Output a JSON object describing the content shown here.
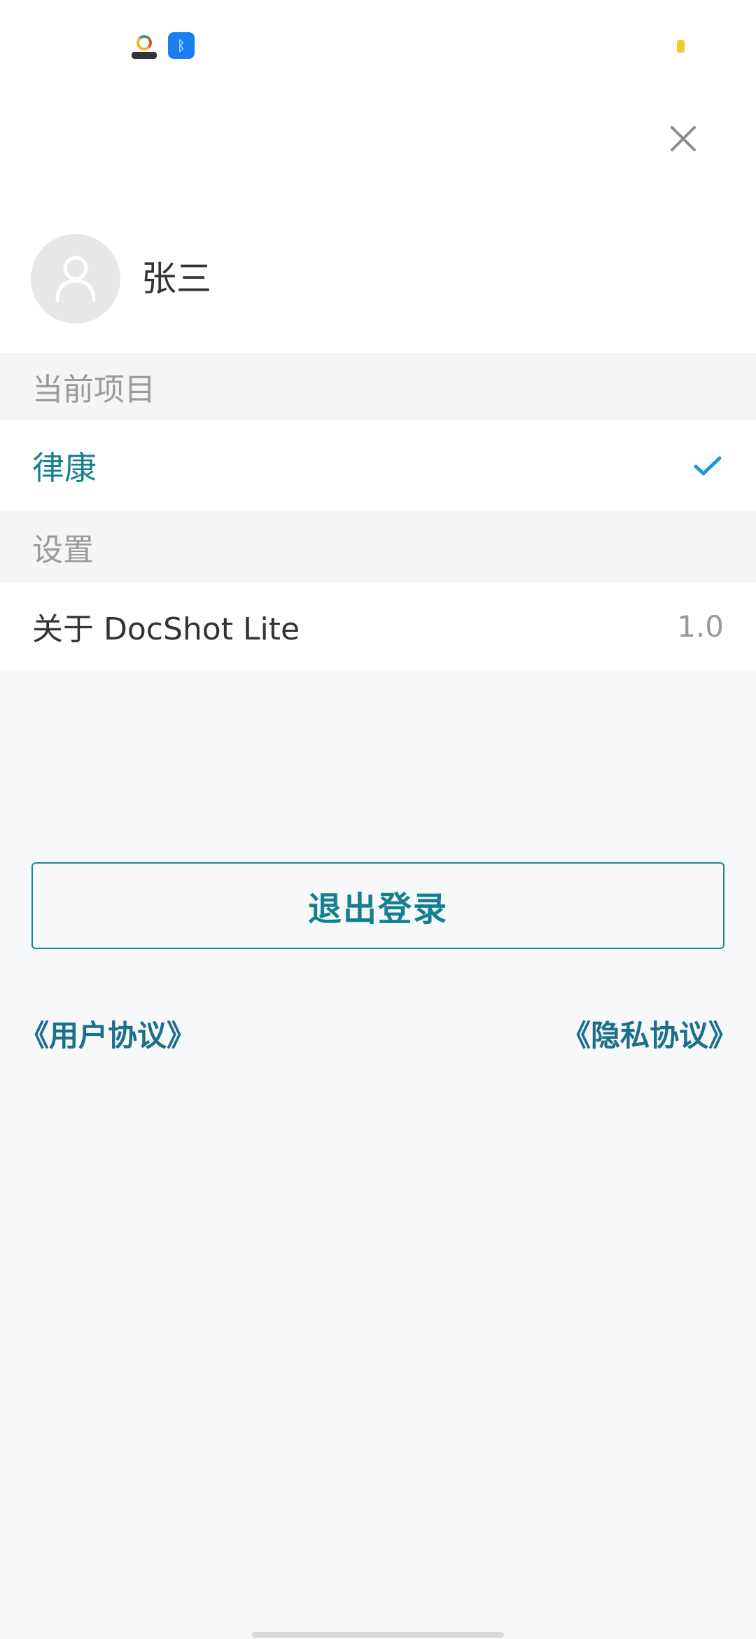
{
  "user": {
    "name": "张三"
  },
  "sections": {
    "current_project": "当前项目",
    "settings": "设置"
  },
  "project": {
    "name": "律康",
    "selected": true
  },
  "about": {
    "label": "关于 DocShot Lite",
    "version": "1.0"
  },
  "actions": {
    "logout_label": "退出登录"
  },
  "links": {
    "user_agreement": "《用户协议》",
    "privacy_policy": "《隐私协议》"
  },
  "colors": {
    "accent": "#14808f",
    "check": "#1a9ad6",
    "section_bg": "#f4f5f6",
    "page_bg": "#f7f8f9"
  },
  "icons": {
    "close": "close-icon",
    "avatar": "user-avatar-icon",
    "check": "check-icon"
  }
}
